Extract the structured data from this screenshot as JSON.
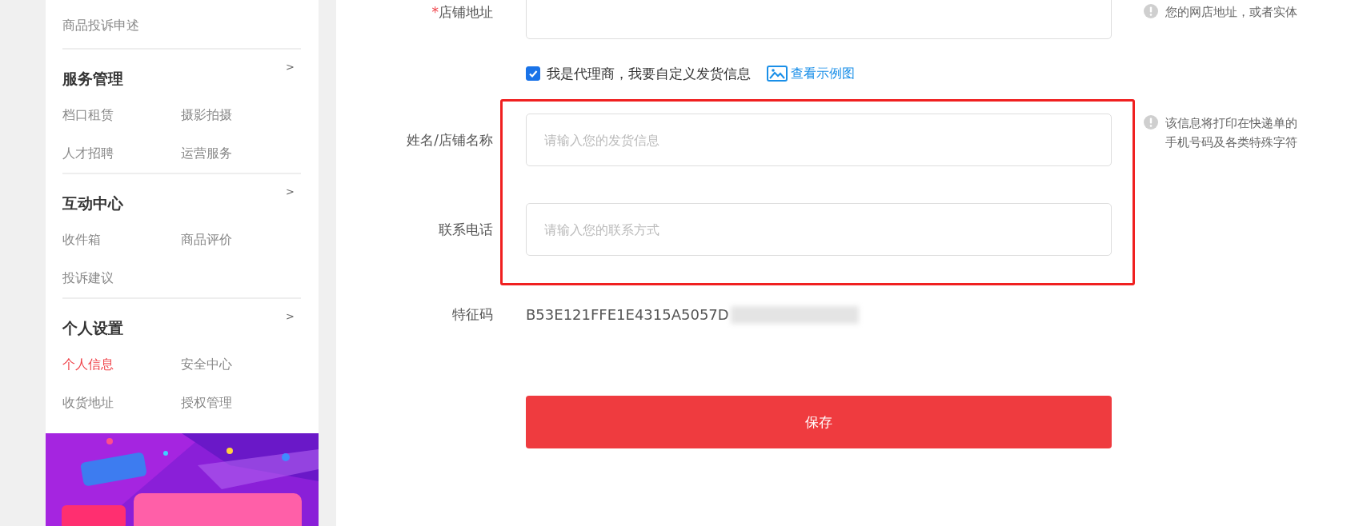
{
  "sidebar": {
    "top_item": {
      "label": "商品投诉申述",
      "selected": false
    },
    "sections": [
      {
        "title": "服务管理",
        "expand_mark": ">",
        "items": [
          {
            "label": "档口租赁",
            "selected": false
          },
          {
            "label": "摄影拍摄",
            "selected": false
          },
          {
            "label": "人才招聘",
            "selected": false
          },
          {
            "label": "运营服务",
            "selected": false
          }
        ]
      },
      {
        "title": "互动中心",
        "expand_mark": ">",
        "items": [
          {
            "label": "收件箱",
            "selected": false
          },
          {
            "label": "商品评价",
            "selected": false
          },
          {
            "label": "投诉建议",
            "selected": false
          }
        ]
      },
      {
        "title": "个人设置",
        "expand_mark": ">",
        "items": [
          {
            "label": "个人信息",
            "selected": true
          },
          {
            "label": "安全中心",
            "selected": false
          },
          {
            "label": "收货地址",
            "selected": false
          },
          {
            "label": "授权管理",
            "selected": false
          }
        ]
      }
    ]
  },
  "form": {
    "address": {
      "label": "店铺地址",
      "required_mark": "*",
      "hint": "您的网店地址，或者实体"
    },
    "agent_option": {
      "label": "我是代理商，我要自定义发货信息",
      "checked": true,
      "link": "查看示例图"
    },
    "sender_fields": [
      {
        "label": "姓名/店铺名称",
        "placeholder": "请输入您的发货信息"
      },
      {
        "label": "联系电话",
        "placeholder": "请输入您的联系方式"
      }
    ],
    "sender_hint": [
      "该信息将打印在快递单的",
      "手机号码及各类特殊字符"
    ],
    "feature_code": {
      "label": "特征码",
      "value": "B53E121FFE1E4315A5057D"
    },
    "save_button": "保存"
  }
}
